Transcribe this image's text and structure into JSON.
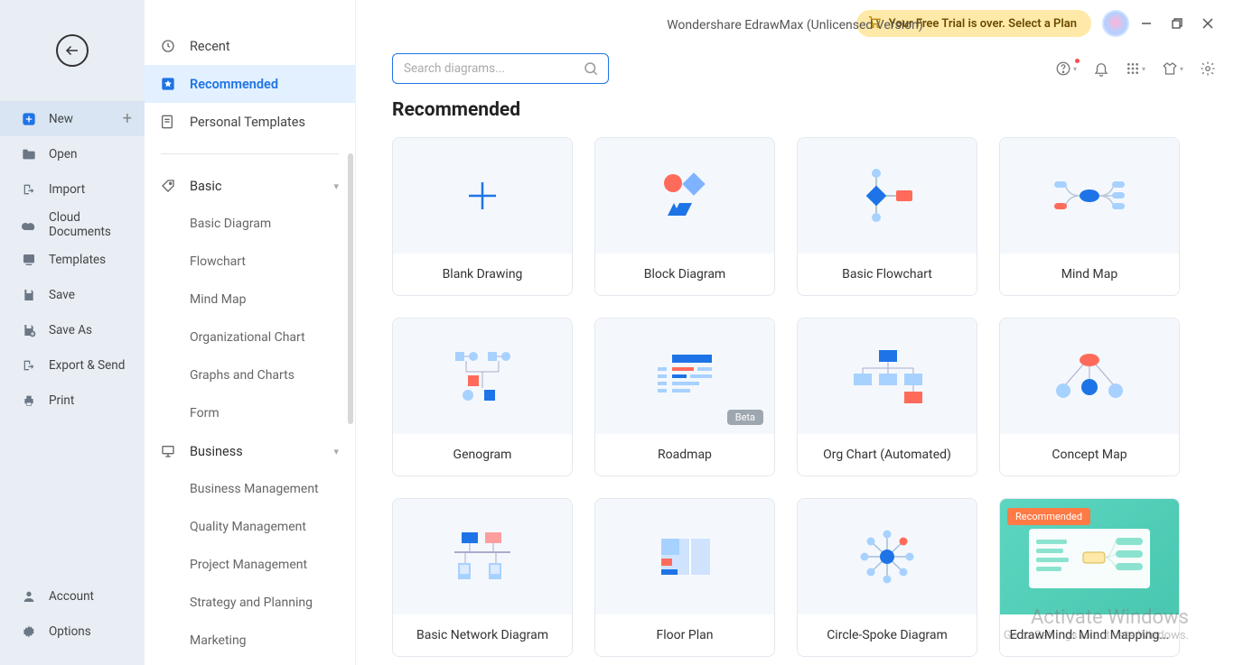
{
  "app": {
    "title": "Wondershare EdrawMax (Unlicensed Version)"
  },
  "trial_banner": "Your Free Trial is over. Select a Plan",
  "search": {
    "placeholder": "Search diagrams..."
  },
  "sidebar1": {
    "items": [
      {
        "label": "New",
        "icon": "plus-square"
      },
      {
        "label": "Open",
        "icon": "folder"
      },
      {
        "label": "Import",
        "icon": "import"
      },
      {
        "label": "Cloud Documents",
        "icon": "cloud"
      },
      {
        "label": "Templates",
        "icon": "templates"
      },
      {
        "label": "Save",
        "icon": "save"
      },
      {
        "label": "Save As",
        "icon": "save-as"
      },
      {
        "label": "Export & Send",
        "icon": "export"
      },
      {
        "label": "Print",
        "icon": "print"
      }
    ],
    "bottom": [
      {
        "label": "Account",
        "icon": "account"
      },
      {
        "label": "Options",
        "icon": "gear"
      }
    ]
  },
  "sidebar2": {
    "top": [
      {
        "label": "Recent",
        "icon": "clock"
      },
      {
        "label": "Recommended",
        "icon": "star"
      },
      {
        "label": "Personal Templates",
        "icon": "doc"
      }
    ],
    "groups": [
      {
        "label": "Basic",
        "icon": "tag",
        "items": [
          "Basic Diagram",
          "Flowchart",
          "Mind Map",
          "Organizational Chart",
          "Graphs and Charts",
          "Form"
        ]
      },
      {
        "label": "Business",
        "icon": "presentation",
        "items": [
          "Business Management",
          "Quality Management",
          "Project Management",
          "Strategy and Planning",
          "Marketing"
        ]
      }
    ]
  },
  "section_title": "Recommended",
  "templates": [
    {
      "label": "Blank Drawing"
    },
    {
      "label": "Block Diagram"
    },
    {
      "label": "Basic Flowchart"
    },
    {
      "label": "Mind Map"
    },
    {
      "label": "Genogram"
    },
    {
      "label": "Roadmap",
      "badge": "Beta"
    },
    {
      "label": "Org Chart (Automated)"
    },
    {
      "label": "Concept Map"
    },
    {
      "label": "Basic Network Diagram"
    },
    {
      "label": "Floor Plan"
    },
    {
      "label": "Circle-Spoke Diagram"
    },
    {
      "label": "EdrawMind: Mind Mapping...",
      "badge": "Recommended"
    }
  ],
  "watermark": {
    "line1": "Activate Windows",
    "line2": "Go to Settings to activate Windows."
  }
}
